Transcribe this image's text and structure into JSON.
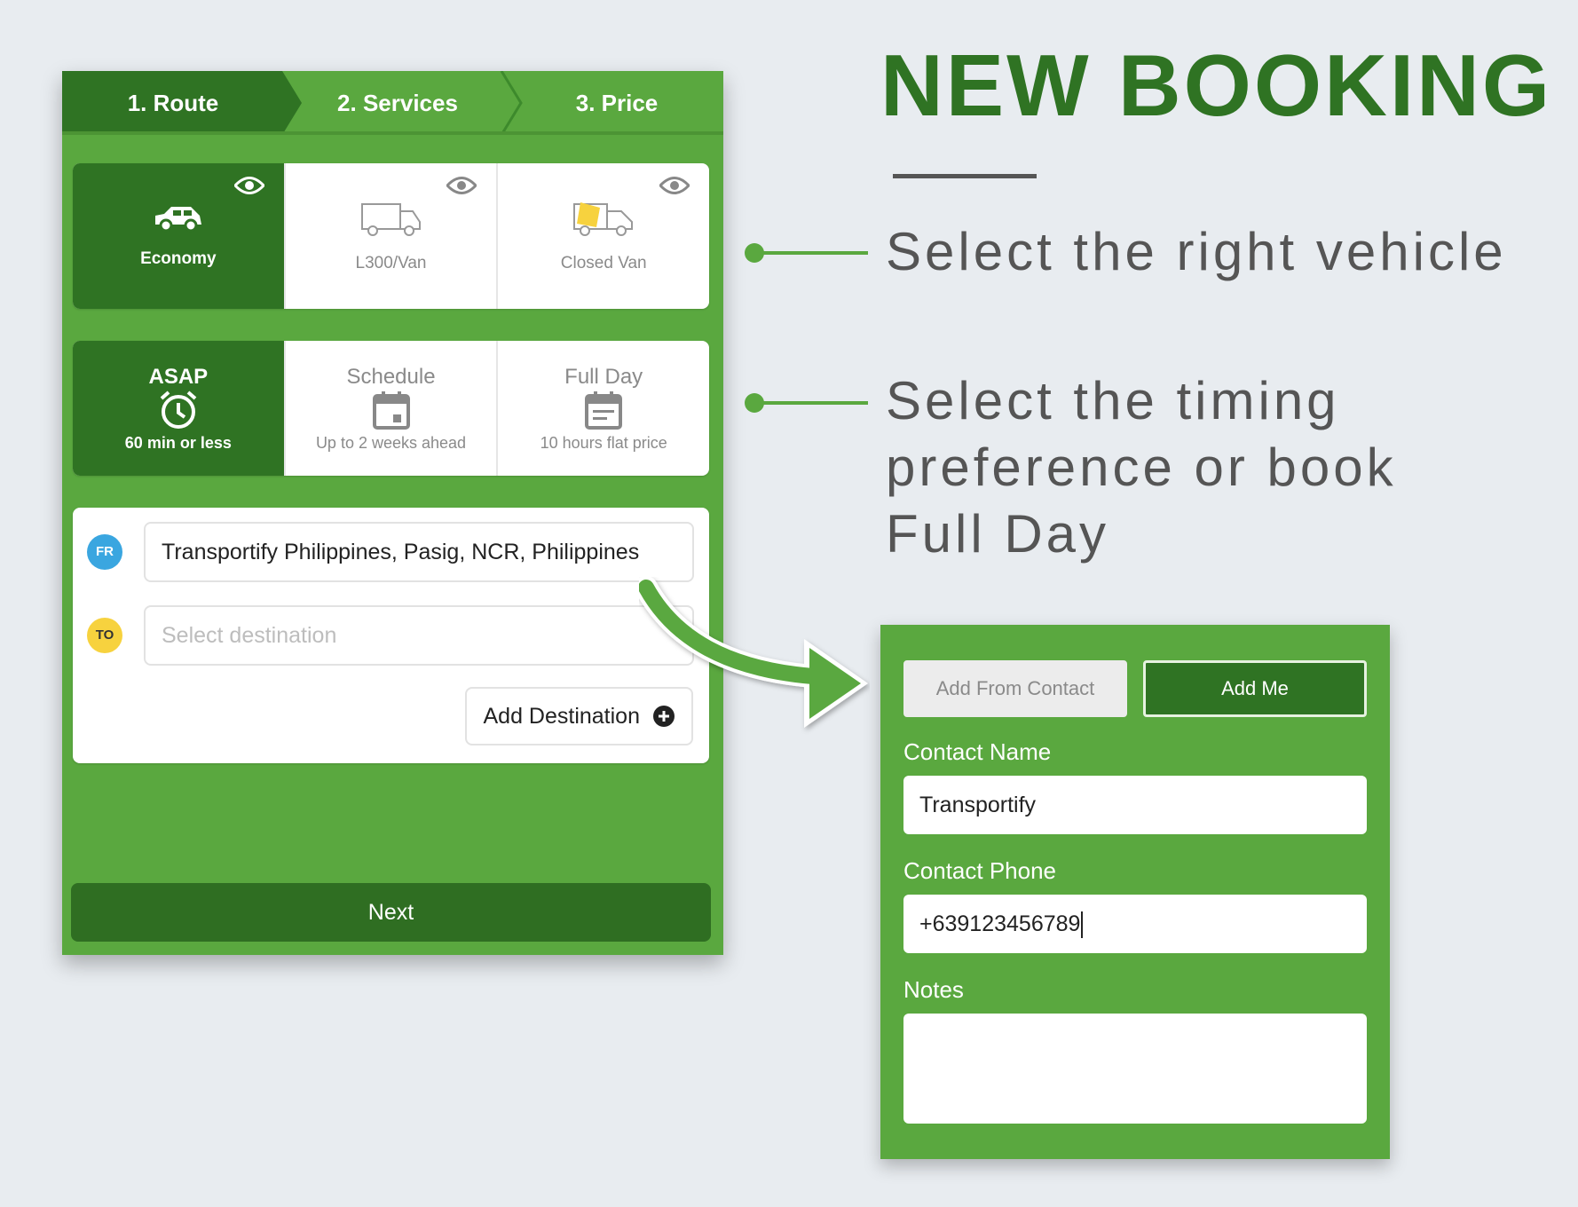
{
  "steps": [
    {
      "label": "1. Route",
      "active": true
    },
    {
      "label": "2. Services",
      "active": false
    },
    {
      "label": "3. Price",
      "active": false
    }
  ],
  "vehicles": [
    {
      "label": "Economy",
      "icon": "car-icon",
      "active": true
    },
    {
      "label": "L300/Van",
      "icon": "van-icon",
      "active": false
    },
    {
      "label": "Closed Van",
      "icon": "closed-van-icon",
      "active": false
    }
  ],
  "timing": [
    {
      "title": "ASAP",
      "sub": "60 min or less",
      "icon": "alarm-clock-icon",
      "active": true
    },
    {
      "title": "Schedule",
      "sub": "Up to 2 weeks ahead",
      "icon": "calendar-icon",
      "active": false
    },
    {
      "title": "Full Day",
      "sub": "10 hours flat price",
      "icon": "calendar-list-icon",
      "active": false
    }
  ],
  "route": {
    "from_badge": "FR",
    "from_value": "Transportify Philippines, Pasig, NCR, Philippines",
    "to_badge": "TO",
    "to_placeholder": "Select destination",
    "add_destination_label": "Add Destination"
  },
  "next_label": "Next",
  "promo": {
    "heading": "NEW BOOKING",
    "feature_vehicle": "Select the right vehicle",
    "feature_timing_lines": [
      "Select the timing",
      "preference or book",
      "Full Day"
    ]
  },
  "contact": {
    "add_from_contact_label": "Add From Contact",
    "add_me_label": "Add Me",
    "name_label": "Contact Name",
    "name_value": "Transportify",
    "phone_label": "Contact Phone",
    "phone_value": "+639123456789",
    "notes_label": "Notes",
    "notes_value": ""
  },
  "colors": {
    "green": "#5aa83f",
    "dark_green": "#2f7323",
    "heading_green": "#2f7323",
    "from_badge": "#3aa6e0",
    "to_badge": "#f7d23e"
  }
}
